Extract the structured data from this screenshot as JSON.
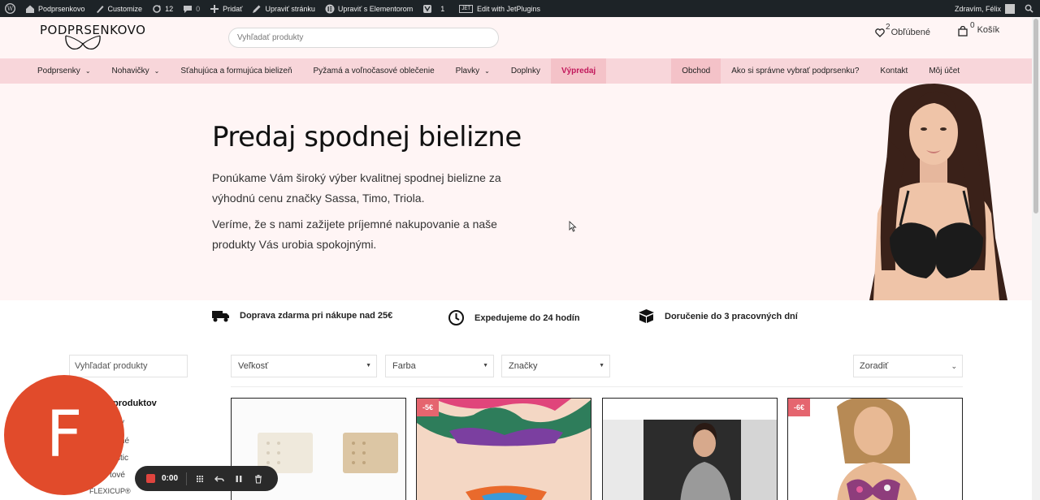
{
  "adminbar": {
    "site_name": "Podprsenkovo",
    "customize": "Customize",
    "updates_count": "12",
    "comments_count": "0",
    "add_new": "Pridať",
    "edit_page": "Upraviť stránku",
    "edit_elementor": "Upraviť s Elementorom",
    "yoast_count": "1",
    "jet_label": "JET",
    "edit_jet": "Edit with JetPlugins",
    "greeting": "Zdravím, Félix"
  },
  "header": {
    "logo_text": "PODPRSENKOVO",
    "search_placeholder": "Vyhľadať produkty",
    "favorites_count": "2",
    "favorites_label": "Obľúbené",
    "cart_count": "0",
    "cart_label": "Košík"
  },
  "nav": {
    "items": [
      {
        "label": "Podprsenky",
        "dropdown": true
      },
      {
        "label": "Nohavičky",
        "dropdown": true
      },
      {
        "label": "Sťahujúca a formujúca bielizeň",
        "dropdown": false
      },
      {
        "label": "Pyžamá a voľnočasové oblečenie",
        "dropdown": false
      },
      {
        "label": "Plavky",
        "dropdown": true
      },
      {
        "label": "Doplnky",
        "dropdown": false
      },
      {
        "label": "Výpredaj",
        "dropdown": false
      }
    ],
    "right_items": [
      {
        "label": "Obchod"
      },
      {
        "label": "Ako si správne vybrať podprsenku?"
      },
      {
        "label": "Kontakt"
      },
      {
        "label": "Môj účet"
      }
    ]
  },
  "hero": {
    "title": "Predaj spodnej bielizne",
    "paragraph1": "Ponúkame Vám široký výber kvalitnej spodnej bielizne za výhodnú cenu značky Sassa, Timo, Triola.",
    "paragraph2": "Veríme, že s nami zažijete príjemné nakupovanie a naše produkty Vás urobia spokojnými."
  },
  "features": [
    {
      "icon": "truck-icon",
      "text": "Doprava zdarma pri nákupe nad 25€"
    },
    {
      "icon": "clock-icon",
      "text": "Expedujeme do 24 hodín"
    },
    {
      "icon": "box-icon",
      "text": "Doručenie do 3 pracovných dní"
    }
  ],
  "sidebar": {
    "search_placeholder": "Vyhľadať produkty",
    "heading": "produktov",
    "links": [
      "y",
      "né",
      "stic",
      "tové",
      "FLEXICUP®"
    ]
  },
  "filters": {
    "size": "Veľkosť",
    "color": "Farba",
    "brand": "Značky",
    "sort": "Zoradiť"
  },
  "products": [
    {
      "badge": ""
    },
    {
      "badge": "-5€"
    },
    {
      "badge": ""
    },
    {
      "badge": "-6€"
    }
  ],
  "overlay": {
    "avatar_letter": "F",
    "timer": "0:00"
  },
  "colors": {
    "nav_bg": "#f8d6da",
    "hero_bg": "#fff5f5",
    "sale_color": "#c2185b",
    "badge_bg": "#e5656f",
    "avatar_bg": "#e14b2b"
  }
}
